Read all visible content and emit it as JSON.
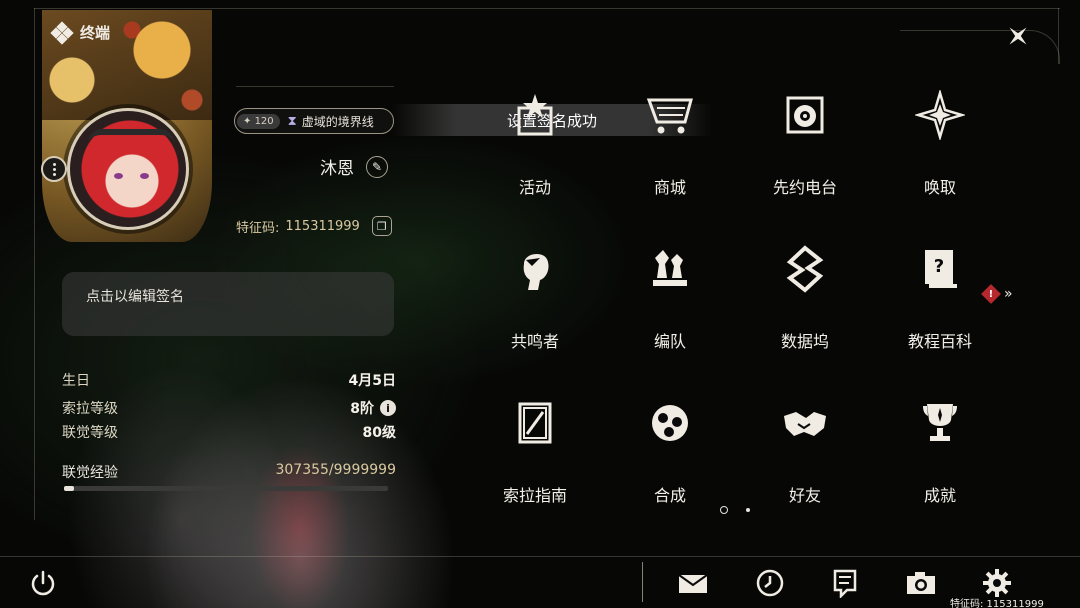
{
  "header": {
    "title": "终端"
  },
  "profile": {
    "level_badge": "120",
    "title_badge": "虚域的境界线",
    "name": "沐恩",
    "uid_label": "特征码:",
    "uid_value": "115311999"
  },
  "toast": {
    "message": "设置签名成功"
  },
  "signature": {
    "placeholder": "点击以编辑签名"
  },
  "stats": [
    {
      "label": "生日",
      "value": "4月5日"
    },
    {
      "label": "索拉等级",
      "value": "8阶"
    },
    {
      "label": "联觉等级",
      "value": "80级"
    }
  ],
  "experience": {
    "label": "联觉经验",
    "value": "307355/9999999",
    "progress": 0.0307
  },
  "menu": [
    {
      "label": "活动",
      "icon": "activity-star-icon"
    },
    {
      "label": "商城",
      "icon": "shop-cart-icon"
    },
    {
      "label": "先约电台",
      "icon": "radio-icon"
    },
    {
      "label": "唤取",
      "icon": "summon-compass-icon"
    },
    {
      "label": "共鸣者",
      "icon": "resonator-head-icon"
    },
    {
      "label": "编队",
      "icon": "team-chess-icon"
    },
    {
      "label": "数据坞",
      "icon": "data-dock-icon"
    },
    {
      "label": "教程百科",
      "icon": "tutorial-book-icon"
    },
    {
      "label": "索拉指南",
      "icon": "guide-book-icon"
    },
    {
      "label": "合成",
      "icon": "synthesis-icon"
    },
    {
      "label": "好友",
      "icon": "handshake-icon"
    },
    {
      "label": "成就",
      "icon": "trophy-icon"
    }
  ],
  "pagination": {
    "current": 1,
    "total": 2
  },
  "footer": {
    "uid_text": "特征码: 115311999"
  },
  "colors": {
    "accent": "#d9c9a0",
    "alert": "#b5282e",
    "text": "#e8e4dc"
  }
}
